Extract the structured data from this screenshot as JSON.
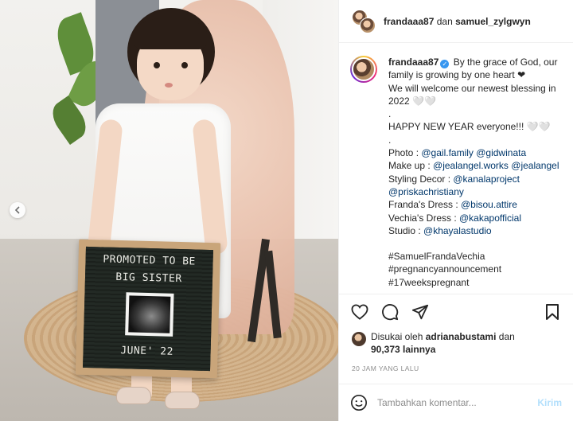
{
  "post_image": {
    "board_lines": [
      "PROMOTED TO BE",
      "BIG SISTER",
      "JUNE' 22"
    ]
  },
  "header": {
    "user1": "frandaaa87",
    "joiner": "dan",
    "user2": "samuel_zylgwyn"
  },
  "caption": {
    "username": "frandaaa87",
    "first_text": "By the grace of God, our family is growing by one heart ❤",
    "lines": [
      "We will welcome our newest blessing in 2022 🤍🤍",
      ".",
      "HAPPY NEW YEAR everyone!!! 🤍🤍",
      "."
    ],
    "credits": [
      {
        "label": "Photo : ",
        "mentions": "@gail.family @gidwinata"
      },
      {
        "label": "Make up : ",
        "mentions": "@jealangel.works @jealangel"
      },
      {
        "label": "Styling Decor : ",
        "mentions": "@kanalaproject"
      },
      {
        "label": "",
        "mentions": "@priskachristiany"
      },
      {
        "label": "Franda's Dress : ",
        "mentions": "@bisou.attire"
      },
      {
        "label": "Vechia's Dress : ",
        "mentions": "@kakapofficial"
      },
      {
        "label": "Studio : ",
        "mentions": "@khayalastudio"
      }
    ],
    "blank": "",
    "hashtags": [
      "#SamuelFrandaVechia",
      "#pregnancyannouncement",
      "#17weekspregnant"
    ]
  },
  "actions": {
    "like_icon": "heart-icon",
    "comment_icon": "comment-bubble-icon",
    "share_icon": "paper-plane-icon",
    "save_icon": "bookmark-icon"
  },
  "likes": {
    "prefix": "Disukai oleh",
    "liker": "adrianabustami",
    "and": "dan",
    "count": "90,373 lainnya"
  },
  "timestamp": "20 JAM YANG LALU",
  "comment_box": {
    "placeholder": "Tambahkan komentar...",
    "post_label": "Kirim"
  },
  "colors": {
    "mention": "#00376b",
    "post_button_disabled": "#b2dffc",
    "verified": "#3897f0",
    "timestamp": "#8e8e8e"
  }
}
